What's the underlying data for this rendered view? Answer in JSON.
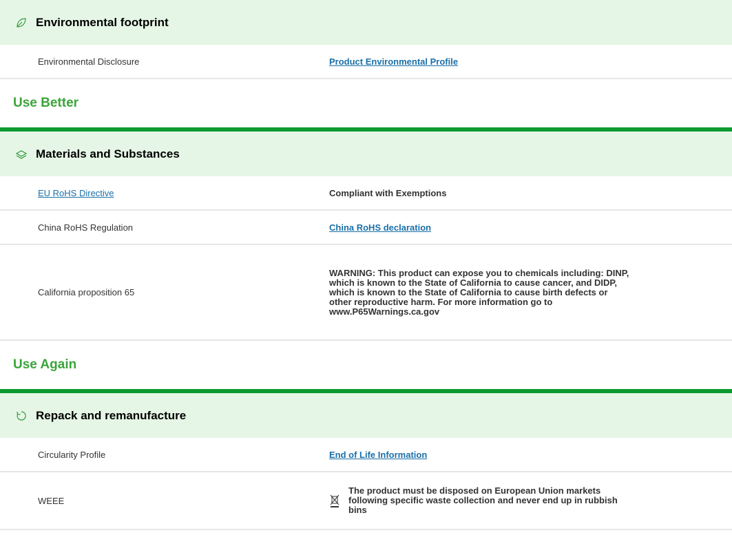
{
  "sections": {
    "env": {
      "title": "Environmental footprint",
      "icon": "leaf-icon",
      "rows": [
        {
          "label": "Environmental Disclosure",
          "value": "Product Environmental Profile"
        }
      ]
    },
    "use_better": {
      "group_title": "Use Better",
      "title": "Materials and Substances",
      "icon": "layers-icon",
      "rows": [
        {
          "label": "EU RoHS Directive",
          "value": "Compliant with Exemptions"
        },
        {
          "label": "China RoHS Regulation",
          "value": "China RoHS declaration"
        },
        {
          "label": "California proposition 65",
          "value": "WARNING: This product can expose you to chemicals including: DINP, which is known to the State of California to cause cancer, and DIDP, which is known to the State of California to cause birth defects or other reproductive harm. For more information go to www.P65Warnings.ca.gov"
        }
      ]
    },
    "use_again": {
      "group_title": "Use Again",
      "title": "Repack and remanufacture",
      "icon": "recycle-icon",
      "rows": [
        {
          "label": "Circularity Profile",
          "value": "End of Life Information"
        },
        {
          "label": "WEEE",
          "value": "The product must be disposed on European Union markets following specific waste collection and never end up in rubbish bins",
          "icon": "crossed-bin-icon"
        }
      ]
    }
  },
  "colors": {
    "header_bg": "#e6f6e6",
    "group_green": "#3aa53a",
    "rule_green": "#0a9a2e",
    "link_blue": "#1a6fa8"
  }
}
